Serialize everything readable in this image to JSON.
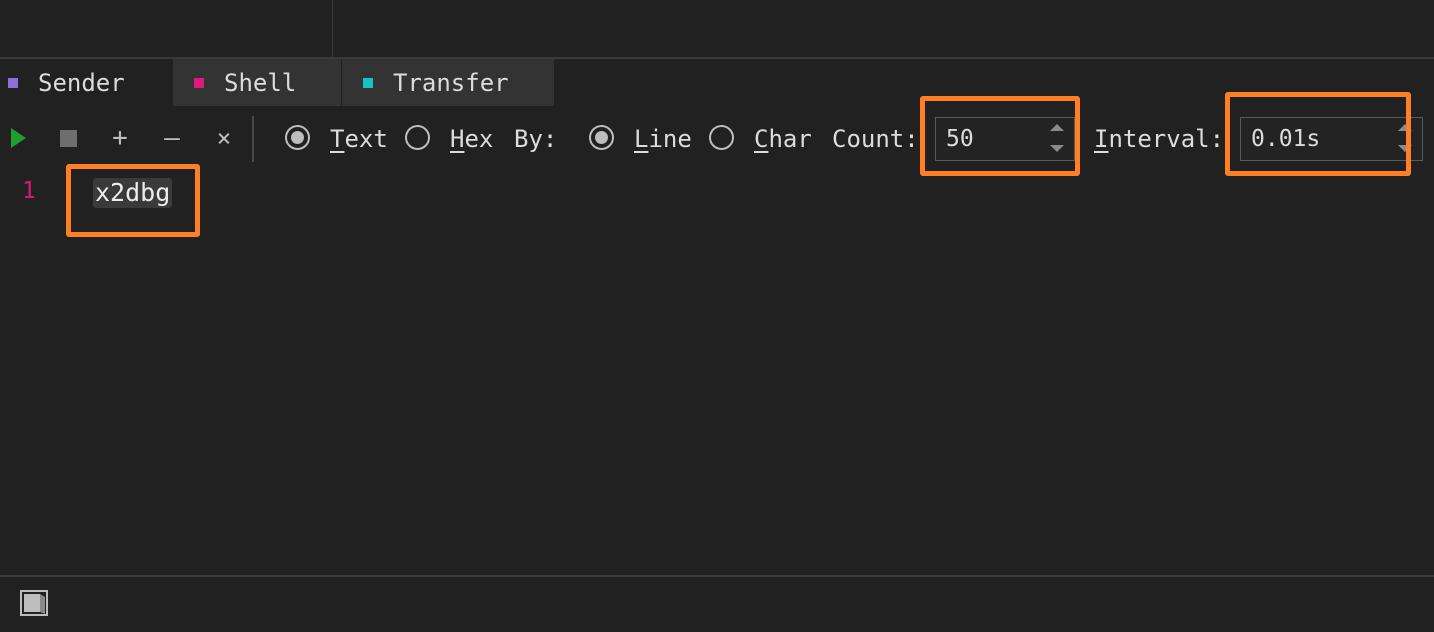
{
  "tabs": [
    {
      "label": "Sender",
      "color": "#8e6fd8"
    },
    {
      "label": "Shell",
      "color": "#e0197d"
    },
    {
      "label": "Transfer",
      "color": "#17c1c9"
    }
  ],
  "toolbar": {
    "play_icon": "play-icon",
    "stop_icon": "stop-icon",
    "add_glyph": "+",
    "remove_glyph": "–",
    "clear_glyph": "×",
    "text_mode": {
      "mnemonic": "T",
      "rest": "ext",
      "selected": true
    },
    "hex_mode": {
      "mnemonic": "H",
      "rest": "ex",
      "selected": false
    },
    "by_label": "By:",
    "line_mode": {
      "mnemonic": "L",
      "rest": "ine",
      "selected": true
    },
    "char_mode": {
      "mnemonic": "C",
      "rest": "har",
      "selected": false
    },
    "count_label": "Count:",
    "count_value": "50",
    "interval_mnemonic": "I",
    "interval_rest": "nterval:",
    "interval_value": "0.01s"
  },
  "editor": {
    "lines": [
      {
        "number": "1",
        "text": "x2dbg"
      }
    ]
  },
  "statusbar": {
    "icon": "panel-icon"
  },
  "colors": {
    "background": "#212121",
    "highlight": "#ff7f27",
    "play": "#1f9f2f",
    "line_number": "#d81b72"
  }
}
